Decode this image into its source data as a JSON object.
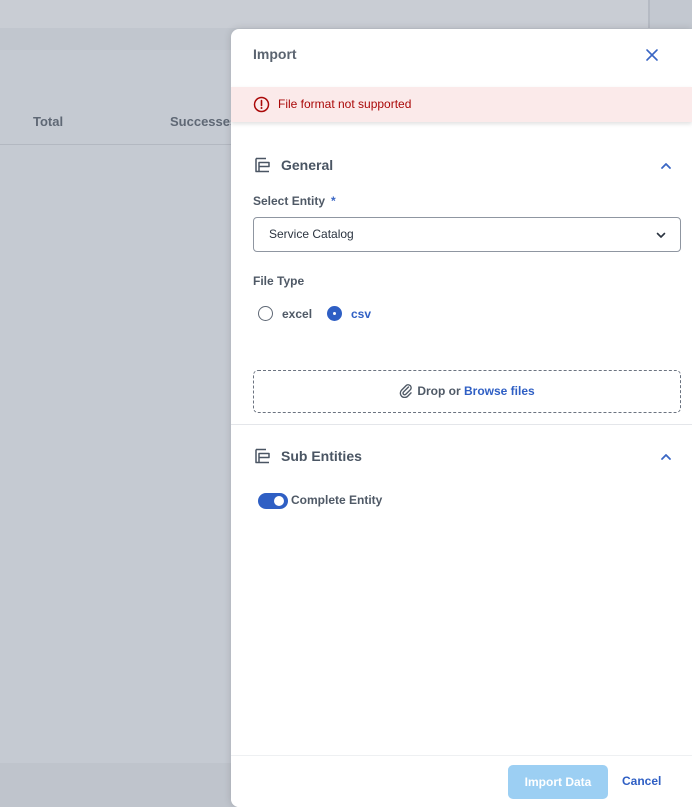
{
  "background": {
    "columns": [
      "Total",
      "Successes"
    ]
  },
  "dialog": {
    "title": "Import",
    "message": {
      "text": "File format not supported",
      "type": "error",
      "icon": "error-icon"
    },
    "general": {
      "title": "General",
      "select_entity": {
        "label": "Select Entity",
        "required_mark": "*",
        "value": "Service Catalog"
      },
      "file_type": {
        "label": "File Type",
        "options": [
          {
            "label": "excel",
            "selected": false
          },
          {
            "label": "csv",
            "selected": true
          }
        ]
      },
      "upload": {
        "drop_text": "Drop or ",
        "browse_text": "Browse files"
      }
    },
    "sub_entities": {
      "title": "Sub Entities",
      "toggle": {
        "label": "Complete Entity",
        "on": true
      }
    },
    "footer": {
      "import_label": "Import Data",
      "cancel_label": "Cancel"
    }
  },
  "colors": {
    "accent": "#2f5fc4",
    "error": "#aa0808",
    "error_bg": "#fbeaea",
    "primary_disabled": "#9ccff3"
  }
}
